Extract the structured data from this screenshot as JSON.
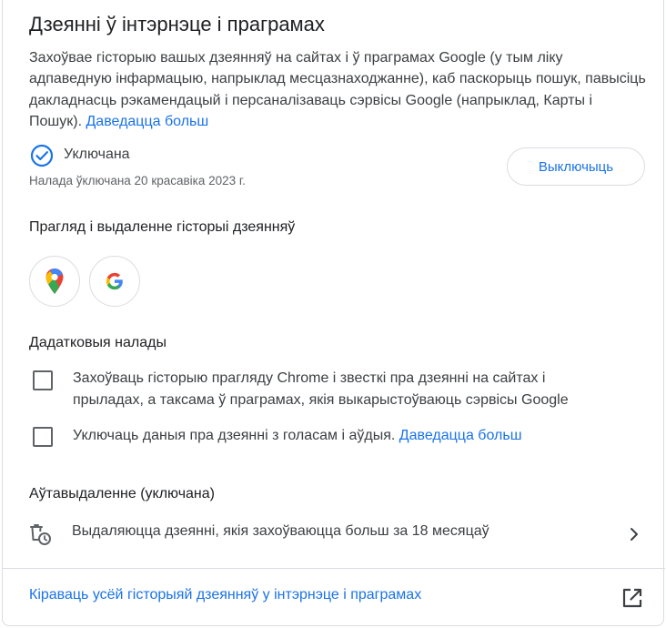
{
  "header": {
    "title": "Дзеянні ў інтэрнэце і праграмах",
    "description": "Захоўвае гісторыю вашых дзеянняў на сайтах і ў праграмах Google (у тым ліку адпаведную інфармацыю, напрыклад месцазнаходжанне), каб паскорыць пошук, павысіць дакладнасць рэкамендацый і персаналізаваць сэрвісы Google (напрыклад, Карты і Пошук).",
    "learn_more": "Даведацца больш"
  },
  "status": {
    "label": "Уключана",
    "date": "Налада ўключана 20 красавіка 2023 г.",
    "turn_off_label": "Выключыць",
    "accent": "#1a73e8"
  },
  "view_section": {
    "heading": "Прагляд і выдаленне гісторыі дзеянняў",
    "apps": [
      {
        "icon": "google-maps-icon"
      },
      {
        "icon": "google-g-icon"
      }
    ]
  },
  "additional": {
    "heading": "Дадатковыя налады",
    "options": [
      {
        "label": "Захоўваць гісторыю прагляду Chrome і звесткі пра дзеянні на сайтах і прыладах, а таксама ў праграмах, якія выкарыстоўваюць сэрвісы Google",
        "checked": false
      },
      {
        "label": "Уключаць даныя пра дзеянні з голасам і аўдыя.",
        "link": "Даведацца больш",
        "checked": false
      }
    ]
  },
  "auto_delete": {
    "heading": "Аўтавыдаленне (уключана)",
    "text": "Выдаляюцца дзеянні, якія захоўваюцца больш за 18 месяцаў"
  },
  "footer": {
    "manage_link": "Кіраваць усёй гісторыяй дзеянняў у інтэрнэце і праграмах"
  }
}
